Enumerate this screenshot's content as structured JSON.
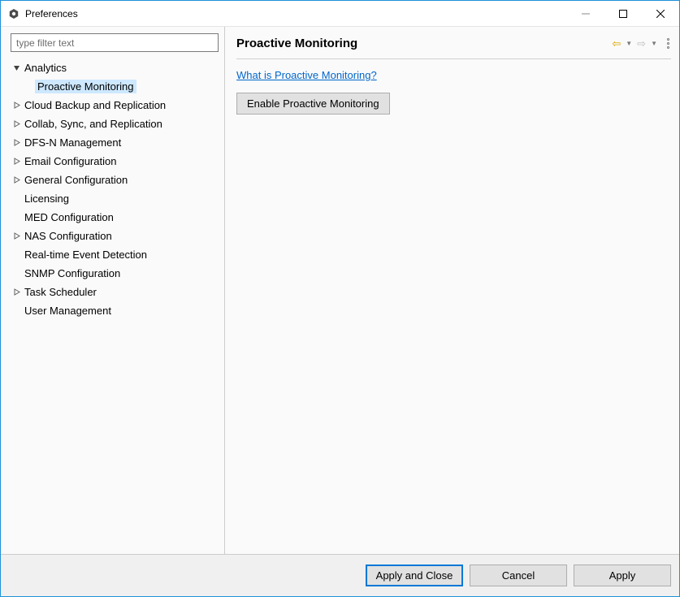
{
  "window": {
    "title": "Preferences"
  },
  "sidebar": {
    "filter_placeholder": "type filter text",
    "items": [
      {
        "label": "Analytics",
        "expanded": true,
        "expandable": true,
        "children": [
          {
            "label": "Proactive Monitoring",
            "selected": true
          }
        ]
      },
      {
        "label": "Cloud Backup and Replication",
        "expandable": true
      },
      {
        "label": "Collab, Sync, and Replication",
        "expandable": true
      },
      {
        "label": "DFS-N Management",
        "expandable": true
      },
      {
        "label": "Email Configuration",
        "expandable": true
      },
      {
        "label": "General Configuration",
        "expandable": true
      },
      {
        "label": "Licensing",
        "expandable": false
      },
      {
        "label": "MED Configuration",
        "expandable": false
      },
      {
        "label": "NAS Configuration",
        "expandable": true
      },
      {
        "label": "Real-time Event Detection",
        "expandable": false
      },
      {
        "label": "SNMP Configuration",
        "expandable": false
      },
      {
        "label": "Task Scheduler",
        "expandable": true
      },
      {
        "label": "User Management",
        "expandable": false
      }
    ]
  },
  "main": {
    "title": "Proactive Monitoring",
    "help_link": "What is Proactive Monitoring?",
    "enable_button": "Enable Proactive Monitoring"
  },
  "footer": {
    "apply_and_close": "Apply and Close",
    "cancel": "Cancel",
    "apply": "Apply"
  }
}
